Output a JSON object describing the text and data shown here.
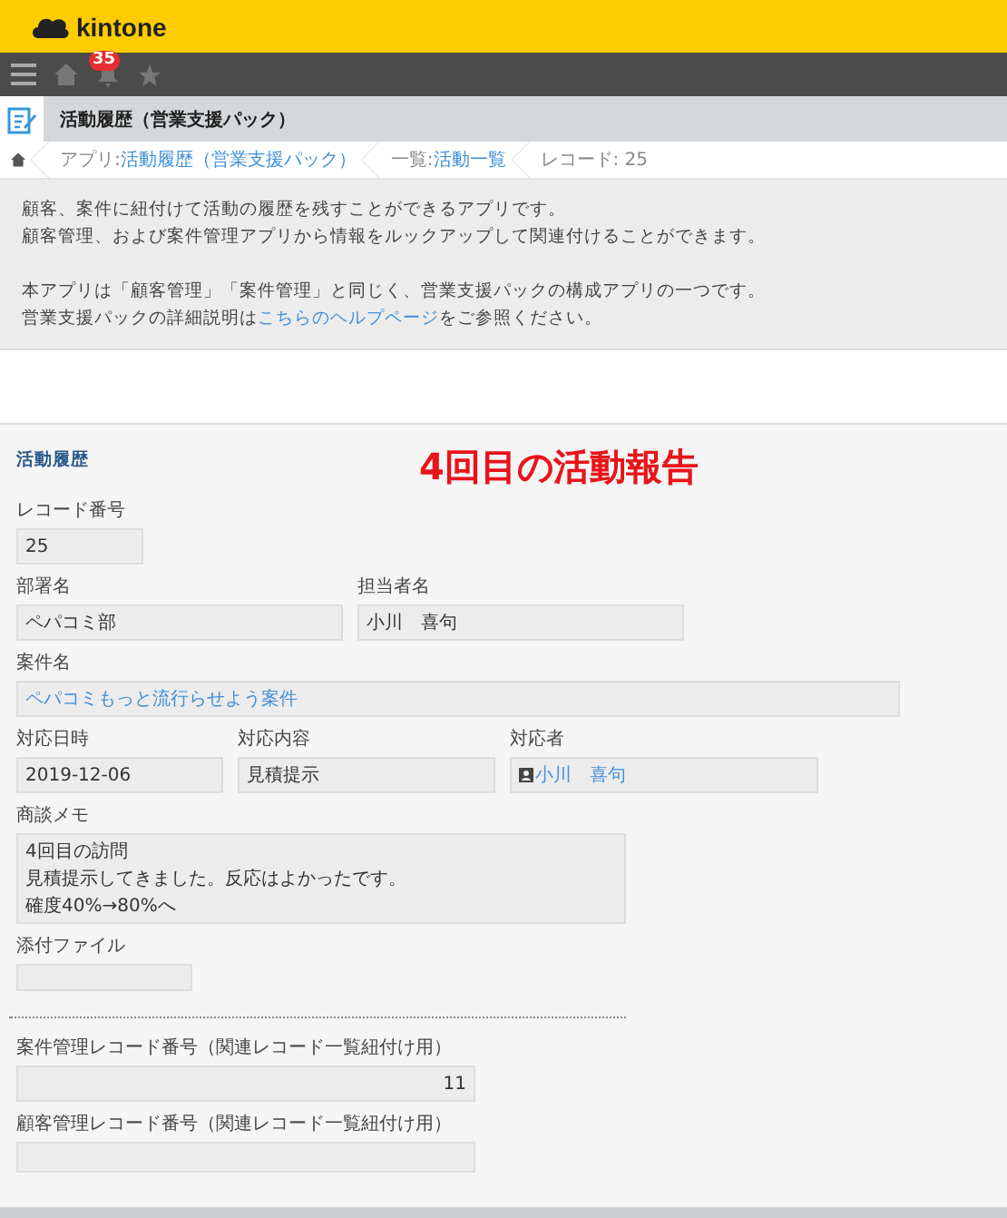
{
  "header": {
    "logo": "kintone"
  },
  "toolbar": {
    "notification_count": "35"
  },
  "app_title": "活動履歴（営業支援パック）",
  "breadcrumb": [
    {
      "label": "アプリ: ",
      "link": "活動履歴（営業支援パック）"
    },
    {
      "label": "一覧: ",
      "link": "活動一覧"
    },
    {
      "label": "レコード: 25"
    }
  ],
  "description": {
    "paragraph_1": [
      "顧客、案件に紐付けて活動の履歴を残すことができるアプリです。",
      "顧客管理、および案件管理アプリから情報をルックアップして関連付けることができます。"
    ],
    "paragraph_2": [
      "本アプリは「顧客管理」「案件管理」と同じく、営業支援パックの構成アプリの一つです。"
    ],
    "last_line": {
      "before": "営業支援パックの詳細説明は",
      "link": "こちらのヘルプページ",
      "after": "をご参照ください。"
    }
  },
  "form": {
    "section_title": "活動履歴",
    "annotation": "4回目の活動報告",
    "rows": [
      [
        {
          "kind": "text",
          "label": "レコード番号",
          "value": "25"
        }
      ],
      [
        {
          "kind": "text",
          "label": "部署名",
          "value": "ペパコミ部"
        },
        {
          "kind": "text",
          "label": "担当者名",
          "value": "小川　喜句"
        }
      ],
      [
        {
          "kind": "link",
          "label": "案件名",
          "value": "ペパコミもっと流行らせよう案件"
        }
      ],
      [
        {
          "kind": "text",
          "label": "対応日時",
          "value": "2019-12-06"
        },
        {
          "kind": "text",
          "label": "対応内容",
          "value": "見積提示"
        },
        {
          "kind": "user",
          "label": "対応者",
          "value": "小川　喜句"
        }
      ],
      [
        {
          "kind": "memo",
          "label": "商談メモ",
          "lines": [
            "4回目の訪問",
            "見積提示してきました。反応はよかったです。",
            "確度40%→80%へ"
          ]
        }
      ],
      [
        {
          "kind": "file",
          "label": "添付ファイル"
        }
      ],
      [
        {
          "kind": "divider"
        }
      ],
      [
        {
          "kind": "number",
          "label": "案件管理レコード番号（関連レコード一覧紐付け用）",
          "value": "11"
        }
      ],
      [
        {
          "kind": "number",
          "label": "顧客管理レコード番号（関連レコード一覧紐付け用）"
        }
      ]
    ]
  }
}
